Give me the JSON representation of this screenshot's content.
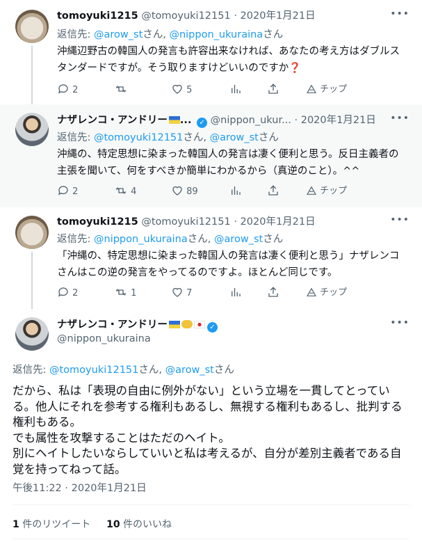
{
  "tweets": [
    {
      "name": "tomoyuki1215",
      "handle": "@tomoyuki12151",
      "sep": " · ",
      "date": "2020年1月21日",
      "reply_prefix": "返信先: ",
      "reply_1": "@arow_st",
      "reply_mid": "さん, ",
      "reply_2": "@nippon_ukuraina",
      "reply_suffix": "さん",
      "text": "沖縄辺野古の韓国人の発言も許容出来なければ、あなたの考え方はダブルスタンダードですが。そう取りますけどいいのですか",
      "text_mark": "❓",
      "replies": "2",
      "retweets": "",
      "likes": "5",
      "tip": "チップ"
    },
    {
      "name": "ナザレンコ・アンドリー",
      "name_suffix": "...",
      "handle": "@nippon_ukur...",
      "sep": " · ",
      "date": "2020年1月21日",
      "reply_prefix": "返信先: ",
      "reply_1": "@tomoyuki12151",
      "reply_mid": "さん, ",
      "reply_2": "@arow_st",
      "reply_suffix": "さん",
      "text": "沖縄の、特定思想に染まった韓国人の発言は凄く便利と思う。反日主義者の主張を聞いて、何をすべきか簡単にわかるから（真逆のこと）。^^",
      "replies": "2",
      "retweets": "4",
      "likes": "89",
      "tip": "チップ"
    },
    {
      "name": "tomoyuki1215",
      "handle": "@tomoyuki12151",
      "sep": " · ",
      "date": "2020年1月21日",
      "reply_prefix": "返信先: ",
      "reply_1": "@nippon_ukuraina",
      "reply_mid": "さん, ",
      "reply_2": "@arow_st",
      "reply_suffix": "さん",
      "text": "「沖縄の、特定思想に染まった韓国人の発言は凄く便利と思う」ナザレンコさんはこの逆の発言をやってるのですよ。ほとんど同じです。",
      "replies": "2",
      "retweets": "1",
      "likes": "7",
      "tip": "チップ"
    }
  ],
  "main": {
    "name": "ナザレンコ・アンドリー",
    "handle": "@nippon_ukuraina",
    "reply_prefix": "返信先: ",
    "reply_1": "@tomoyuki12151",
    "reply_mid": "さん, ",
    "reply_2": "@arow_st",
    "reply_suffix": "さん",
    "text": "だから、私は「表現の自由に例外がない」という立場を一貫してとっている。他人にそれを参考する権利もあるし、無視する権利もあるし、批判する権利もある。\nでも属性を攻撃することはただのヘイト。\n別にヘイトしたいならしていいと私は考えるが、自分が差別主義者である自覚を持ってねって話。",
    "timestamp": "午後11:22 · 2020年1月21日",
    "retweet_count": "1",
    "retweet_label": " 件のリツイート",
    "like_count": "10",
    "like_label": " 件のいいね"
  },
  "colors": {
    "accent": "#1d9bf0",
    "muted": "#536471",
    "text": "#0f1419"
  }
}
